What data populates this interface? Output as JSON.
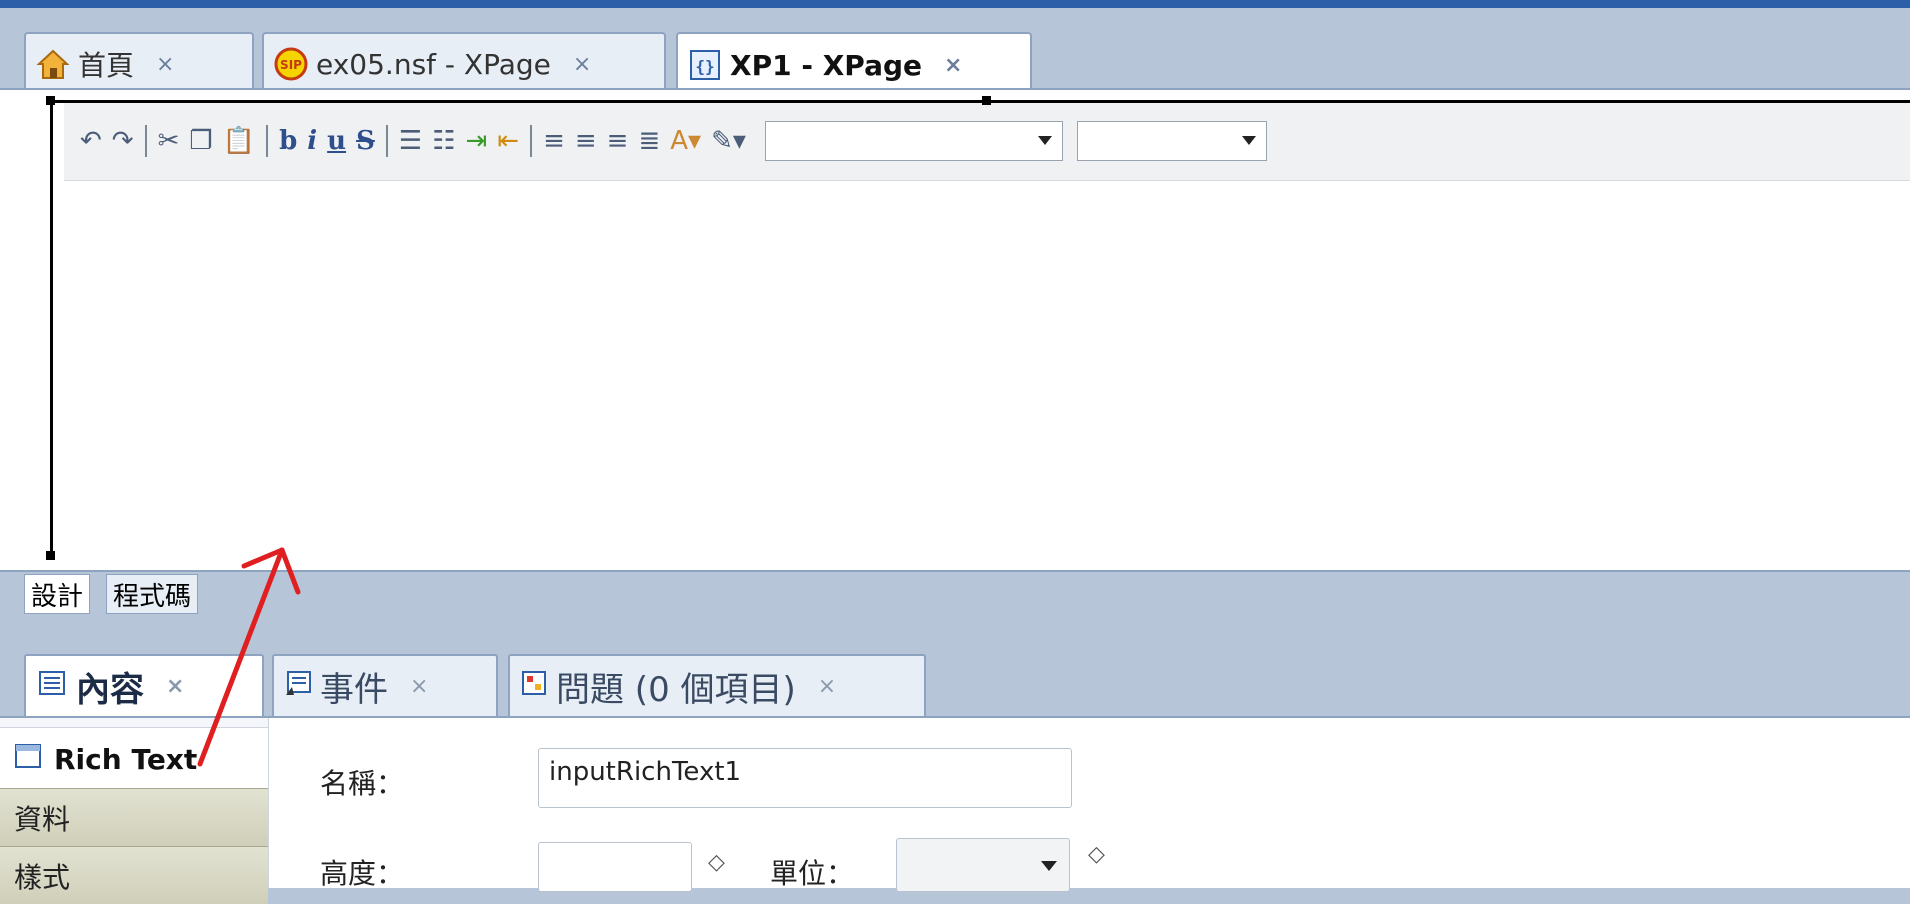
{
  "tabs": [
    {
      "label": "首頁",
      "icon": "home-icon",
      "close": "×"
    },
    {
      "label": "ex05.nsf - XPage",
      "icon": "database-icon",
      "close": "×"
    },
    {
      "label": "XP1 - XPage",
      "icon": "xpage-icon",
      "close": "×"
    }
  ],
  "toolbar": {
    "buttons": [
      "undo-icon",
      "redo-icon",
      "cut-icon",
      "copy-icon",
      "paste-icon",
      "bold-icon",
      "italic-icon",
      "underline-icon",
      "strikethrough-icon",
      "numbered-list-icon",
      "bulleted-list-icon",
      "indent-icon",
      "outdent-icon",
      "align-left-icon",
      "align-right-icon",
      "align-center-icon",
      "justify-icon",
      "font-color-icon",
      "highlight-icon"
    ],
    "bold": "b",
    "italic": "i",
    "underline": "u",
    "strike": "S",
    "font_family_value": "",
    "font_size_value": ""
  },
  "editor_tabs": {
    "design": "設計",
    "source": "程式碼"
  },
  "panel_tabs": [
    {
      "label": "內容",
      "close": "×"
    },
    {
      "label": "事件",
      "close": "×"
    },
    {
      "label": "問題 (0 個項目)",
      "close": "×"
    }
  ],
  "side": {
    "selected": "Rich Text",
    "items": [
      "資料",
      "樣式"
    ]
  },
  "props": {
    "name_label": "名稱：",
    "name_value": "inputRichText1",
    "height_label": "高度：",
    "height_value": "",
    "unit_label": "單位：",
    "unit_value": ""
  },
  "colors": {
    "accent": "#2d5fa8",
    "panel_bg": "#b6c5d8",
    "annotation_arrow": "#e02020"
  }
}
